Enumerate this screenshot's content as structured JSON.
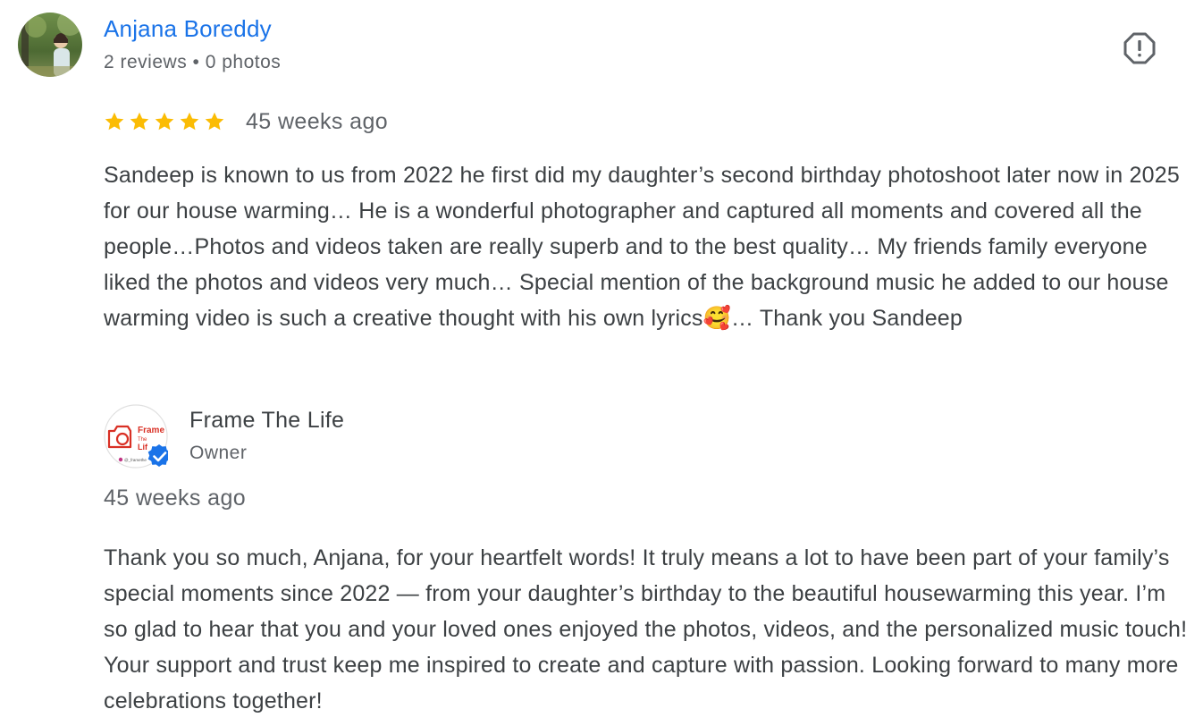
{
  "review": {
    "reviewer_name": "Anjana Boreddy",
    "reviewer_meta": "2 reviews • 0 photos",
    "rating": 5,
    "rating_max": 5,
    "date": "45 weeks ago",
    "text": "Sandeep is known to us from 2022 he first did my daughter’s second birthday photoshoot later now in 2025 for our house warming… He is a wonderful photographer and captured all moments and covered all the people…Photos and videos taken are really superb and to the best quality… My friends family everyone liked the photos and videos very much… Special mention of the background music he added to our house warming video is such a creative thought with his own lyrics🥰… Thank you Sandeep",
    "report_icon": "report-flag-icon"
  },
  "owner_reply": {
    "owner_name": "Frame The Life",
    "owner_role": "Owner",
    "logo_text_line1": "Frame",
    "logo_text_line2": "The",
    "logo_text_line3": "Lif",
    "logo_handle": "@_framethe",
    "verified_icon": "verified-badge-icon",
    "date": "45 weeks ago",
    "text": "Thank you so much, Anjana, for your heartfelt words! It truly means a lot to have been part of your family’s special moments since 2022 — from your daughter’s birthday to the beautiful housewarming this year. I’m so glad to hear that you and your loved ones enjoyed the photos, videos, and the personalized music touch! Your support and trust keep me inspired to create and capture with passion. Looking forward to many more celebrations together!"
  },
  "colors": {
    "name_link": "#1a73e8",
    "star": "#fbbc04",
    "secondary_text": "#5f6368",
    "body_text": "#3c4043",
    "verified": "#1a73e8",
    "logo_red": "#d93025"
  }
}
